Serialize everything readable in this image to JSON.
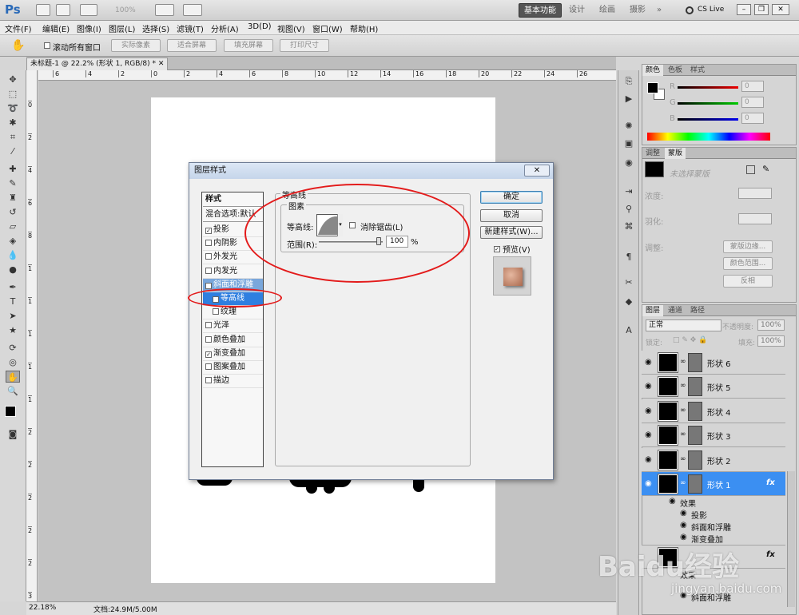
{
  "app": {
    "logo": "Ps",
    "zoom": "100%",
    "workspaces": [
      "基本功能",
      "设计",
      "绘画",
      "摄影"
    ],
    "more": "»",
    "cslive": "CS Live"
  },
  "menu": [
    "文件(F)",
    "编辑(E)",
    "图像(I)",
    "图层(L)",
    "选择(S)",
    "滤镜(T)",
    "分析(A)",
    "3D(D)",
    "视图(V)",
    "窗口(W)",
    "帮助(H)"
  ],
  "options": {
    "scroll_all": "滚动所有窗口",
    "buttons": [
      "实际像素",
      "适合屏幕",
      "填充屏幕",
      "打印尺寸"
    ]
  },
  "document": {
    "tab": "未标题-1 @ 22.2% (形状 1, RGB/8) *",
    "ruler_h": [
      "6",
      "4",
      "2",
      "0",
      "2",
      "4",
      "6",
      "8",
      "10",
      "12",
      "14",
      "16",
      "18",
      "20",
      "22",
      "24",
      "26"
    ],
    "ruler_v": [
      "0",
      "2",
      "4",
      "6",
      "8",
      "1",
      "1",
      "1",
      "1",
      "1",
      "2",
      "2",
      "2",
      "2",
      "2",
      "3"
    ]
  },
  "status": {
    "zoom": "22.18%",
    "doc": "文档:24.9M/5.00M"
  },
  "color_panel": {
    "tabs": [
      "颜色",
      "色板",
      "样式"
    ],
    "channels": [
      {
        "name": "R",
        "value": "0"
      },
      {
        "name": "G",
        "value": "0"
      },
      {
        "name": "B",
        "value": "0"
      }
    ]
  },
  "masks_panel": {
    "tabs": [
      "调整",
      "蒙版"
    ],
    "hint": "未选择蒙版",
    "density": "浓度:",
    "feather": "羽化:",
    "refine": "调整:",
    "buttons": [
      "蒙版边缘...",
      "颜色范围...",
      "反相"
    ]
  },
  "layers_panel": {
    "tabs": [
      "图层",
      "通道",
      "路径"
    ],
    "blend": "正常",
    "opacity_label": "不透明度:",
    "opacity": "100%",
    "lock_label": "锁定:",
    "fill_label": "填充:",
    "fill": "100%",
    "layers": [
      {
        "name": "形状 6"
      },
      {
        "name": "形状 5"
      },
      {
        "name": "形状 4"
      },
      {
        "name": "形状 3"
      },
      {
        "name": "形状 2"
      },
      {
        "name": "形状 1",
        "fx": "fx"
      }
    ],
    "effects_label": "效果",
    "effects": [
      "投影",
      "斜面和浮雕",
      "渐变叠加"
    ],
    "lower_effects_label": "效果",
    "lower_effect": "斜面和浮雕",
    "lower_fx": "fx"
  },
  "dialog": {
    "title": "图层样式",
    "close": "✕",
    "styles_header": "样式",
    "blend_default": "混合选项:默认",
    "items": [
      {
        "label": "投影",
        "checked": true
      },
      {
        "label": "内阴影",
        "checked": false
      },
      {
        "label": "外发光",
        "checked": false
      },
      {
        "label": "内发光",
        "checked": false
      },
      {
        "label": "斜面和浮雕",
        "checked": true
      },
      {
        "label": "等高线",
        "checked": true
      },
      {
        "label": "纹理",
        "checked": false
      },
      {
        "label": "光泽",
        "checked": false
      },
      {
        "label": "颜色叠加",
        "checked": false
      },
      {
        "label": "渐变叠加",
        "checked": true
      },
      {
        "label": "图案叠加",
        "checked": false
      },
      {
        "label": "描边",
        "checked": false
      }
    ],
    "group_title": "等高线",
    "sub_title": "图素",
    "contour_label": "等高线:",
    "antialias": "消除锯齿(L)",
    "range_label": "范围(R):",
    "range_value": "100",
    "range_unit": "%",
    "range_fraction": 1.0,
    "ok": "确定",
    "cancel": "取消",
    "new_style": "新建样式(W)...",
    "preview": "预览(V)"
  },
  "watermark": {
    "text": "Baidu经验",
    "url": "jingyan.baidu.com"
  },
  "colors": {
    "selection": "#3b8ff2",
    "annotation": "#e31b1b"
  }
}
